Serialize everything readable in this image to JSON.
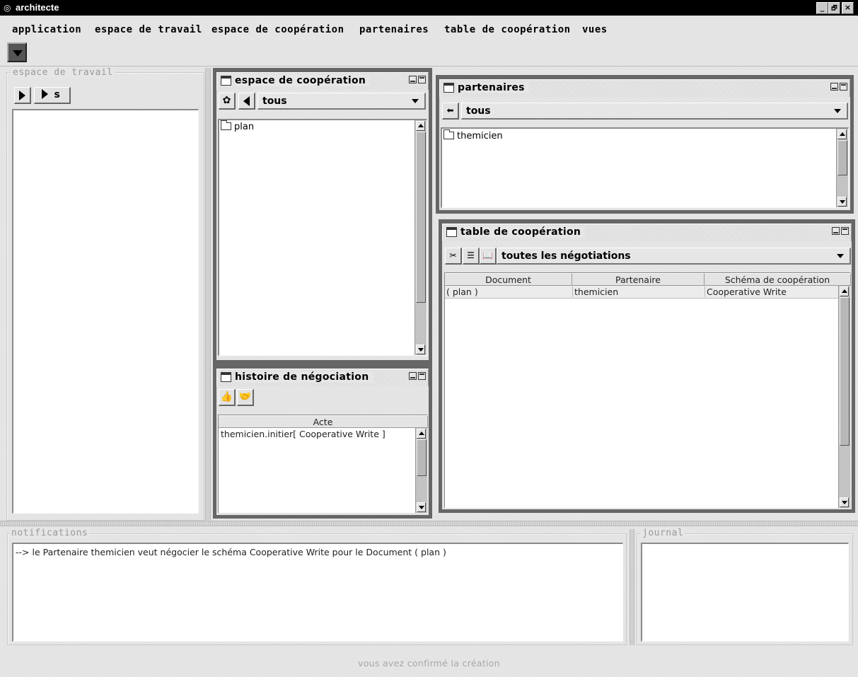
{
  "window": {
    "title": "architecte",
    "controls": [
      "_",
      "🗗",
      "×"
    ]
  },
  "menu": [
    "application",
    "espace de travail",
    "espace de coopération",
    "partenaires",
    "table de coopération",
    "vues"
  ],
  "workspace": {
    "label": "espace de travail",
    "button_s": "s"
  },
  "coop_space": {
    "title": "espace de coopération",
    "filter": "tous",
    "items": [
      "plan"
    ]
  },
  "history": {
    "title": "histoire de négociation",
    "column": "Acte",
    "rows": [
      "themicien.initier[ Cooperative Write ]"
    ]
  },
  "partners": {
    "title": "partenaires",
    "filter": "tous",
    "items": [
      "themicien"
    ]
  },
  "coop_table": {
    "title": "table de coopération",
    "filter": "toutes les négotiations",
    "columns": [
      "Document",
      "Partenaire",
      "Schéma de coopération"
    ],
    "rows": [
      [
        "( plan )",
        "themicien",
        "Cooperative Write"
      ]
    ]
  },
  "notifications": {
    "label": "notifications",
    "lines": [
      "--> le Partenaire themicien veut négocier le schéma Cooperative Write pour le Document ( plan )"
    ]
  },
  "journal": {
    "label": "journal"
  },
  "status": {
    "message": "vous avez confirmé la création"
  }
}
